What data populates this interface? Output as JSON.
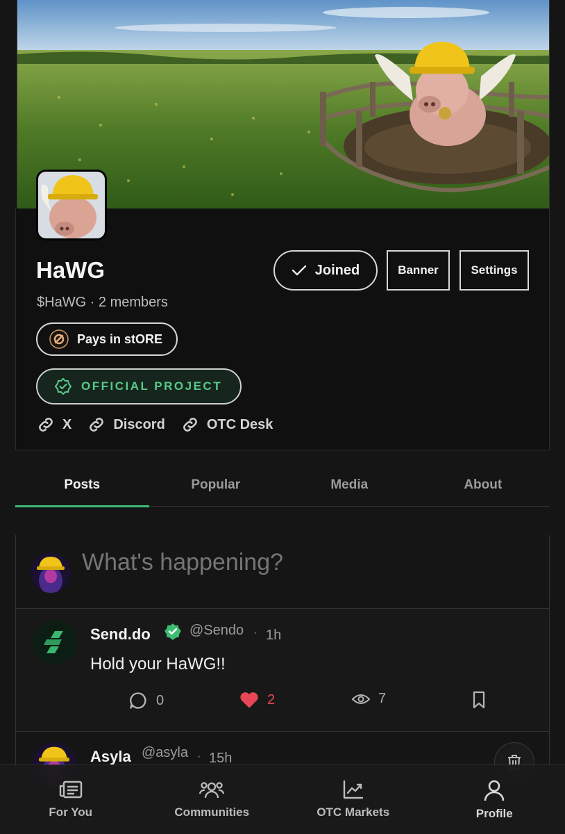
{
  "community": {
    "name": "HaWG",
    "subtitle": "$HaWG · 2 members",
    "joined_label": "Joined",
    "banner_label": "Banner",
    "settings_label": "Settings",
    "pays_label": "Pays in stORE",
    "official_label": "OFFICIAL PROJECT",
    "links": [
      {
        "label": "X"
      },
      {
        "label": "Discord"
      },
      {
        "label": "OTC Desk"
      }
    ]
  },
  "tabs": [
    {
      "label": "Posts",
      "active": true
    },
    {
      "label": "Popular",
      "active": false
    },
    {
      "label": "Media",
      "active": false
    },
    {
      "label": "About",
      "active": false
    }
  ],
  "composer": {
    "placeholder": "What's happening?"
  },
  "posts": [
    {
      "name": "Send.do",
      "handle": "@Sendo",
      "dot": "·",
      "time": "1h",
      "text": "Hold your HaWG!!",
      "replies": "0",
      "likes": "2",
      "views": "7",
      "verified": true
    },
    {
      "name": "Asyla",
      "handle": "@asyla",
      "dot": "·",
      "time": "15h"
    }
  ],
  "bottom_nav": [
    {
      "label": "For You",
      "icon": "newspaper-icon"
    },
    {
      "label": "Communities",
      "icon": "people-icon"
    },
    {
      "label": "OTC Markets",
      "icon": "chart-icon"
    },
    {
      "label": "Profile",
      "icon": "user-icon"
    }
  ],
  "colors": {
    "accent_green": "#3dbb77",
    "like_red": "#e84855",
    "background": "#151515"
  }
}
